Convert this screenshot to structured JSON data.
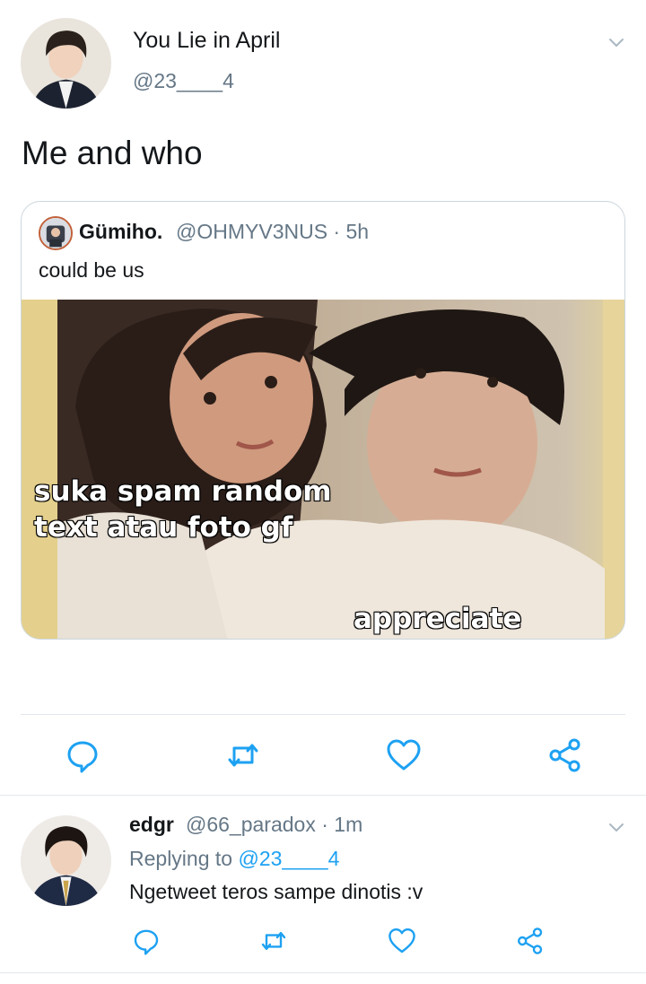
{
  "main_tweet": {
    "display_name": "You Lie in April",
    "handle": "@23____4",
    "text": "Me and who"
  },
  "quoted_tweet": {
    "display_name": "Gümiho.",
    "handle_time": "@OHMYV3NUS · 5h",
    "text": "could be us",
    "image_caption_1": "suka spam random\ntext atau foto gf",
    "image_caption_2": "appreciate"
  },
  "actions": {
    "reply_icon": "reply-icon",
    "retweet_icon": "retweet-icon",
    "like_icon": "heart-icon",
    "share_icon": "share-icon"
  },
  "reply_tweet": {
    "display_name": "edgr",
    "handle_time": "@66_paradox · 1m",
    "replying_prefix": "Replying to",
    "replying_handle": "@23____4",
    "text": "Ngetweet teros sampe dinotis :v"
  },
  "colors": {
    "text_primary": "#14171a",
    "text_secondary": "#657786",
    "link": "#1da1f2",
    "icon": "#1da1f2",
    "border": "#ccd6dd"
  }
}
